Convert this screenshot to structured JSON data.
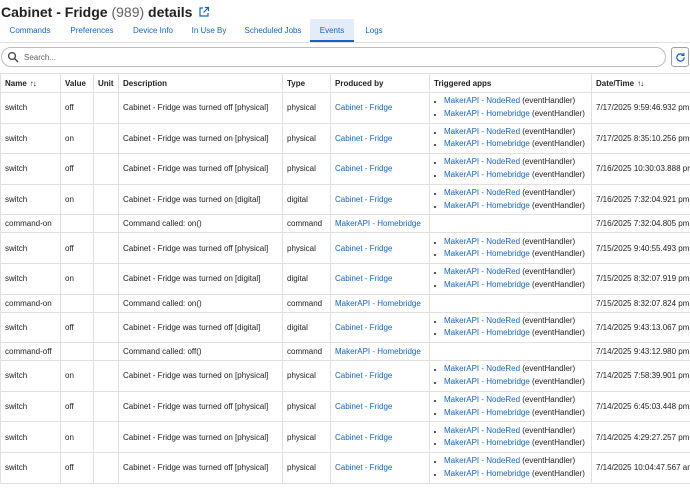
{
  "header": {
    "title": "Cabinet - Fridge",
    "count": "(989)",
    "suffix": "details"
  },
  "tabs": [
    {
      "label": "Commands",
      "active": false
    },
    {
      "label": "Preferences",
      "active": false
    },
    {
      "label": "Device Info",
      "active": false
    },
    {
      "label": "In Use By",
      "active": false
    },
    {
      "label": "Scheduled Jobs",
      "active": false
    },
    {
      "label": "Events",
      "active": true
    },
    {
      "label": "Logs",
      "active": false
    }
  ],
  "search": {
    "placeholder": "Search...",
    "value": ""
  },
  "columns": {
    "name": "Name",
    "value": "Value",
    "unit": "Unit",
    "description": "Description",
    "type": "Type",
    "produced_by": "Produced by",
    "triggered_apps": "Triggered apps",
    "datetime": "Date/Time"
  },
  "sort_glyph": "↑↓",
  "colors": {
    "accent": "#1565c0",
    "active_tab_bg": "#e3ecf8",
    "border": "#e0e0e0"
  },
  "rows": [
    {
      "name": "switch",
      "value": "off",
      "unit": "",
      "desc": "Cabinet - Fridge was turned off [physical]",
      "type": "physical",
      "producer": "Cabinet - Fridge",
      "apps": [
        {
          "app": "MakerAPI - NodeRed",
          "handler": "(eventHandler)"
        },
        {
          "app": "MakerAPI - Homebridge",
          "handler": "(eventHandler)"
        }
      ],
      "time": "7/17/2025 9:59:46.932 pm"
    },
    {
      "name": "switch",
      "value": "on",
      "unit": "",
      "desc": "Cabinet - Fridge was turned on [physical]",
      "type": "physical",
      "producer": "Cabinet - Fridge",
      "apps": [
        {
          "app": "MakerAPI - NodeRed",
          "handler": "(eventHandler)"
        },
        {
          "app": "MakerAPI - Homebridge",
          "handler": "(eventHandler)"
        }
      ],
      "time": "7/17/2025 8:35:10.256 pm"
    },
    {
      "name": "switch",
      "value": "off",
      "unit": "",
      "desc": "Cabinet - Fridge was turned off [physical]",
      "type": "physical",
      "producer": "Cabinet - Fridge",
      "apps": [
        {
          "app": "MakerAPI - NodeRed",
          "handler": "(eventHandler)"
        },
        {
          "app": "MakerAPI - Homebridge",
          "handler": "(eventHandler)"
        }
      ],
      "time": "7/16/2025 10:30:03.888 pm"
    },
    {
      "name": "switch",
      "value": "on",
      "unit": "",
      "desc": "Cabinet - Fridge was turned on [digital]",
      "type": "digital",
      "producer": "Cabinet - Fridge",
      "apps": [
        {
          "app": "MakerAPI - NodeRed",
          "handler": "(eventHandler)"
        },
        {
          "app": "MakerAPI - Homebridge",
          "handler": "(eventHandler)"
        }
      ],
      "time": "7/16/2025 7:32:04.921 pm"
    },
    {
      "name": "command-on",
      "value": "",
      "unit": "",
      "desc": "Command called: on()",
      "type": "command",
      "producer": "MakerAPI - Homebridge",
      "apps": [],
      "time": "7/16/2025 7:32:04.805 pm"
    },
    {
      "name": "switch",
      "value": "off",
      "unit": "",
      "desc": "Cabinet - Fridge was turned off [physical]",
      "type": "physical",
      "producer": "Cabinet - Fridge",
      "apps": [
        {
          "app": "MakerAPI - NodeRed",
          "handler": "(eventHandler)"
        },
        {
          "app": "MakerAPI - Homebridge",
          "handler": "(eventHandler)"
        }
      ],
      "time": "7/15/2025 9:40:55.493 pm"
    },
    {
      "name": "switch",
      "value": "on",
      "unit": "",
      "desc": "Cabinet - Fridge was turned on [digital]",
      "type": "digital",
      "producer": "Cabinet - Fridge",
      "apps": [
        {
          "app": "MakerAPI - NodeRed",
          "handler": "(eventHandler)"
        },
        {
          "app": "MakerAPI - Homebridge",
          "handler": "(eventHandler)"
        }
      ],
      "time": "7/15/2025 8:32:07.919 pm"
    },
    {
      "name": "command-on",
      "value": "",
      "unit": "",
      "desc": "Command called: on()",
      "type": "command",
      "producer": "MakerAPI - Homebridge",
      "apps": [],
      "time": "7/15/2025 8:32:07.824 pm"
    },
    {
      "name": "switch",
      "value": "off",
      "unit": "",
      "desc": "Cabinet - Fridge was turned off [digital]",
      "type": "digital",
      "producer": "Cabinet - Fridge",
      "apps": [
        {
          "app": "MakerAPI - NodeRed",
          "handler": "(eventHandler)"
        },
        {
          "app": "MakerAPI - Homebridge",
          "handler": "(eventHandler)"
        }
      ],
      "time": "7/14/2025 9:43:13.067 pm"
    },
    {
      "name": "command-off",
      "value": "",
      "unit": "",
      "desc": "Command called: off()",
      "type": "command",
      "producer": "MakerAPI - Homebridge",
      "apps": [],
      "time": "7/14/2025 9:43:12.980 pm"
    },
    {
      "name": "switch",
      "value": "on",
      "unit": "",
      "desc": "Cabinet - Fridge was turned on [physical]",
      "type": "physical",
      "producer": "Cabinet - Fridge",
      "apps": [
        {
          "app": "MakerAPI - NodeRed",
          "handler": "(eventHandler)"
        },
        {
          "app": "MakerAPI - Homebridge",
          "handler": "(eventHandler)"
        }
      ],
      "time": "7/14/2025 7:58:39.901 pm"
    },
    {
      "name": "switch",
      "value": "off",
      "unit": "",
      "desc": "Cabinet - Fridge was turned off [physical]",
      "type": "physical",
      "producer": "Cabinet - Fridge",
      "apps": [
        {
          "app": "MakerAPI - NodeRed",
          "handler": "(eventHandler)"
        },
        {
          "app": "MakerAPI - Homebridge",
          "handler": "(eventHandler)"
        }
      ],
      "time": "7/14/2025 6:45:03.448 pm"
    },
    {
      "name": "switch",
      "value": "on",
      "unit": "",
      "desc": "Cabinet - Fridge was turned on [physical]",
      "type": "physical",
      "producer": "Cabinet - Fridge",
      "apps": [
        {
          "app": "MakerAPI - NodeRed",
          "handler": "(eventHandler)"
        },
        {
          "app": "MakerAPI - Homebridge",
          "handler": "(eventHandler)"
        }
      ],
      "time": "7/14/2025 4:29:27.257 pm"
    },
    {
      "name": "switch",
      "value": "off",
      "unit": "",
      "desc": "Cabinet - Fridge was turned off [physical]",
      "type": "physical",
      "producer": "Cabinet - Fridge",
      "apps": [
        {
          "app": "MakerAPI - NodeRed",
          "handler": "(eventHandler)"
        },
        {
          "app": "MakerAPI - Homebridge",
          "handler": "(eventHandler)"
        }
      ],
      "time": "7/14/2025 10:04:47.567 am"
    }
  ]
}
